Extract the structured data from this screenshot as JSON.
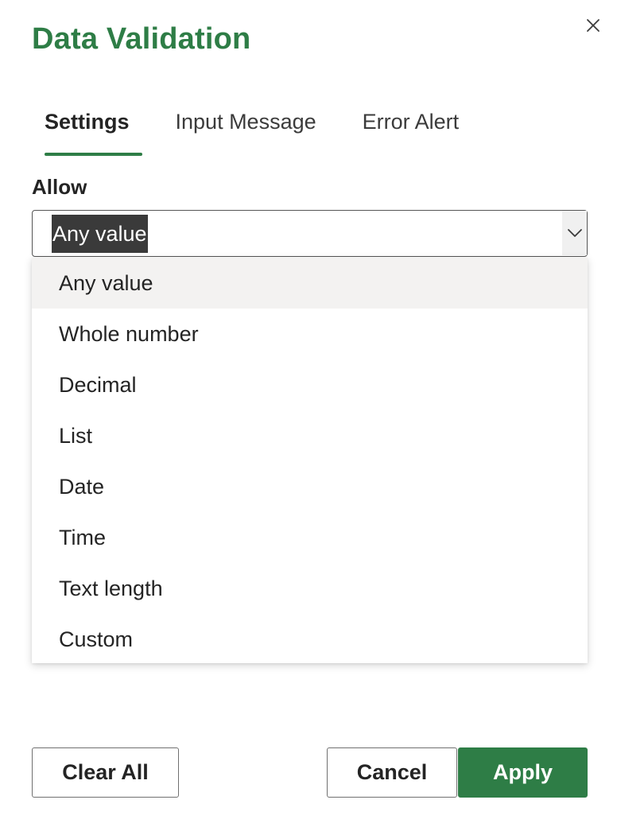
{
  "dialog": {
    "title": "Data Validation",
    "close_icon": "close-icon",
    "accent_color": "#2e7d46"
  },
  "tabs": [
    {
      "label": "Settings",
      "active": true
    },
    {
      "label": "Input Message",
      "active": false
    },
    {
      "label": "Error Alert",
      "active": false
    }
  ],
  "allow": {
    "label": "Allow",
    "selected_value": "Any value",
    "arrow_icon": "chevron-down-icon",
    "options": [
      {
        "label": "Any value",
        "selected": true
      },
      {
        "label": "Whole number",
        "selected": false
      },
      {
        "label": "Decimal",
        "selected": false
      },
      {
        "label": "List",
        "selected": false
      },
      {
        "label": "Date",
        "selected": false
      },
      {
        "label": "Time",
        "selected": false
      },
      {
        "label": "Text length",
        "selected": false
      },
      {
        "label": "Custom",
        "selected": false
      }
    ]
  },
  "buttons": {
    "clear_all": "Clear All",
    "cancel": "Cancel",
    "apply": "Apply"
  }
}
